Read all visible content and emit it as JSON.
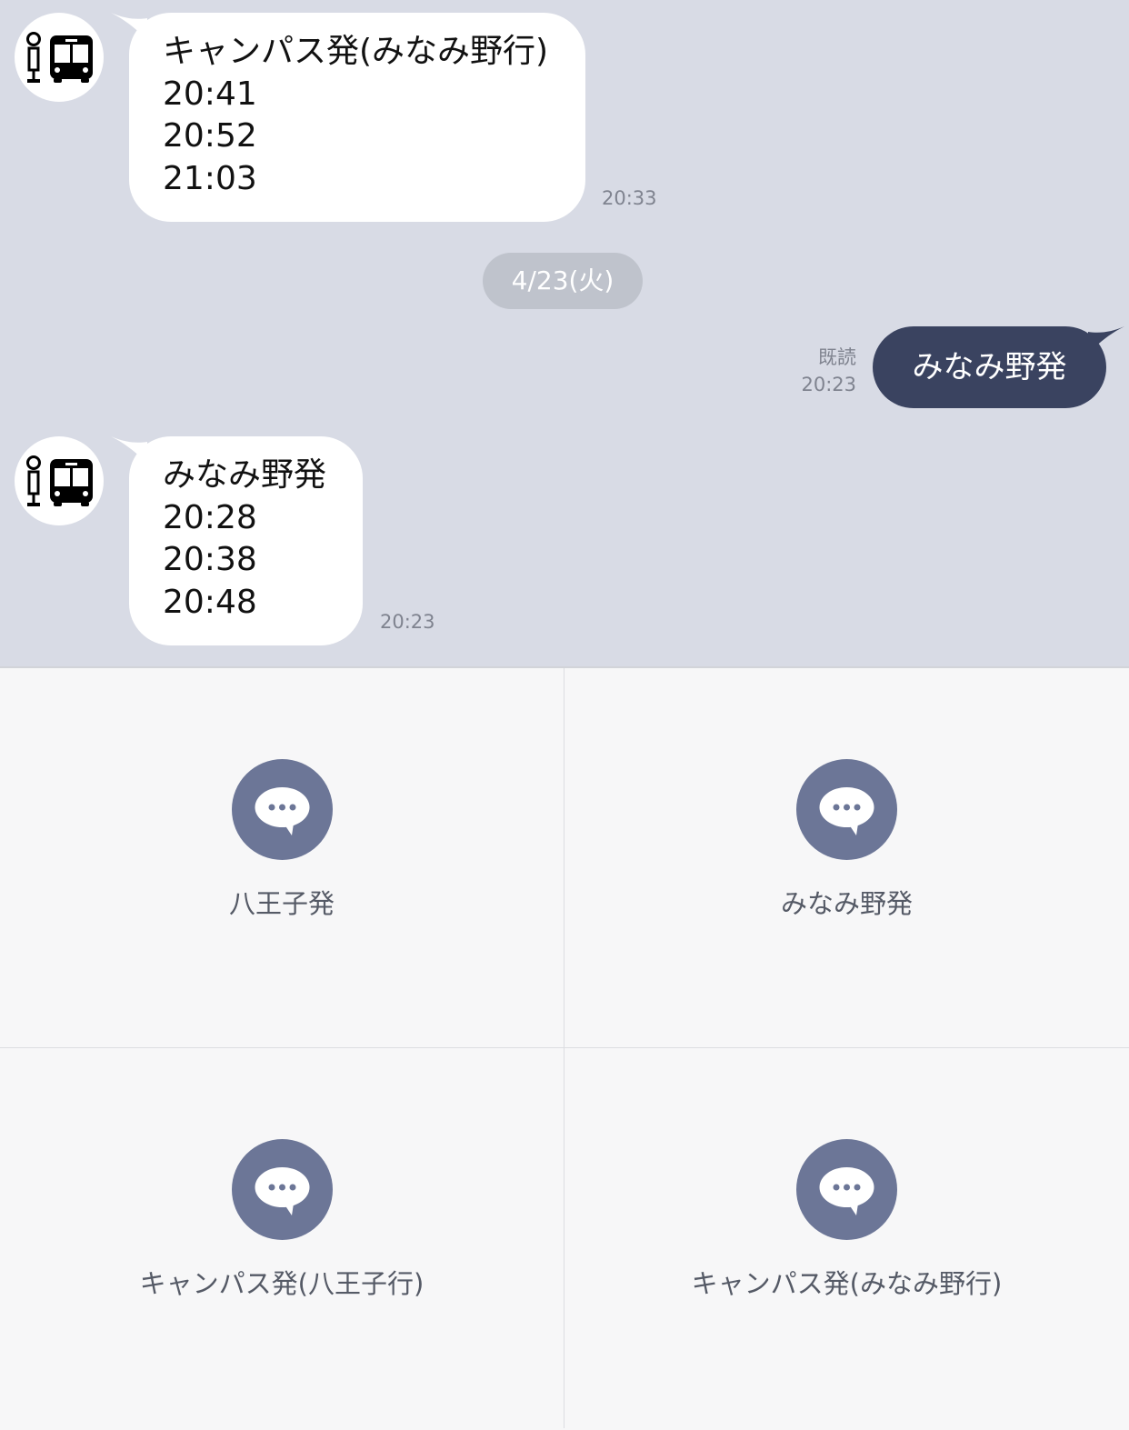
{
  "messages": {
    "first": {
      "lines": [
        "キャンパス発(みなみ野行)",
        "20:41",
        "20:52",
        "21:03"
      ],
      "time": "20:33"
    },
    "date_separator": "4/23(火)",
    "sent": {
      "text": "みなみ野発",
      "read_label": "既読",
      "time": "20:23"
    },
    "second": {
      "lines": [
        "みなみ野発",
        "20:28",
        "20:38",
        "20:48"
      ],
      "time": "20:23"
    },
    "avatar_icon": "bus-stop-icon"
  },
  "rich_menu": {
    "icon": "chat-bubble-icon",
    "items": [
      {
        "label": "八王子発"
      },
      {
        "label": "みなみ野発"
      },
      {
        "label": "キャンパス発(八王子行)"
      },
      {
        "label": "キャンパス発(みなみ野行)"
      }
    ]
  },
  "colors": {
    "chat_background": "#d8dbe5",
    "sent_bubble": "#3a4360",
    "menu_icon": "#6c7697",
    "menu_background": "#f7f7f8"
  }
}
